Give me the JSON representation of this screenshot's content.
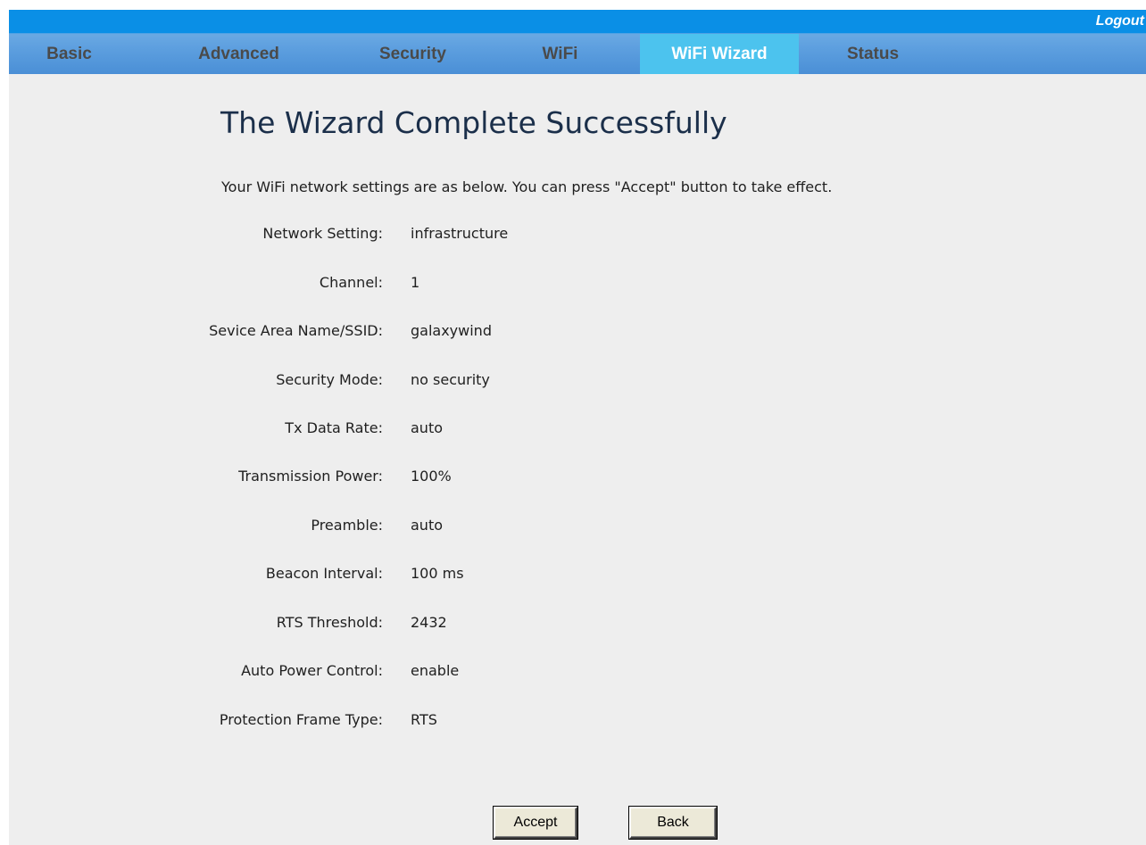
{
  "header": {
    "logout_label": "Logout"
  },
  "tabs": [
    {
      "label": "Basic",
      "active": false
    },
    {
      "label": "Advanced",
      "active": false
    },
    {
      "label": "Security",
      "active": false
    },
    {
      "label": "WiFi",
      "active": false
    },
    {
      "label": "WiFi Wizard",
      "active": true
    },
    {
      "label": "Status",
      "active": false
    }
  ],
  "main": {
    "title": "The Wizard Complete Successfully",
    "description": "Your WiFi network settings are as below. You can press \"Accept\" button to take effect.",
    "settings": [
      {
        "label": "Network Setting:",
        "value": "infrastructure"
      },
      {
        "label": "Channel:",
        "value": "1"
      },
      {
        "label": "Sevice Area Name/SSID:",
        "value": "galaxywind"
      },
      {
        "label": "Security Mode:",
        "value": "no security"
      },
      {
        "label": "Tx Data Rate:",
        "value": "auto"
      },
      {
        "label": "Transmission Power:",
        "value": "100%"
      },
      {
        "label": "Preamble:",
        "value": "auto"
      },
      {
        "label": "Beacon Interval:",
        "value": "100 ms"
      },
      {
        "label": "RTS Threshold:",
        "value": "2432"
      },
      {
        "label": "Auto Power Control:",
        "value": "enable"
      },
      {
        "label": "Protection Frame Type:",
        "value": "RTS"
      }
    ]
  },
  "buttons": {
    "accept_label": "Accept",
    "back_label": "Back"
  },
  "colors": {
    "header_blue": "#0a8fe6",
    "tab_bar": "#5d9fdf",
    "active_tab": "#4cc3ee",
    "content_bg": "#eeeeee",
    "title_text": "#1b2f4a"
  }
}
